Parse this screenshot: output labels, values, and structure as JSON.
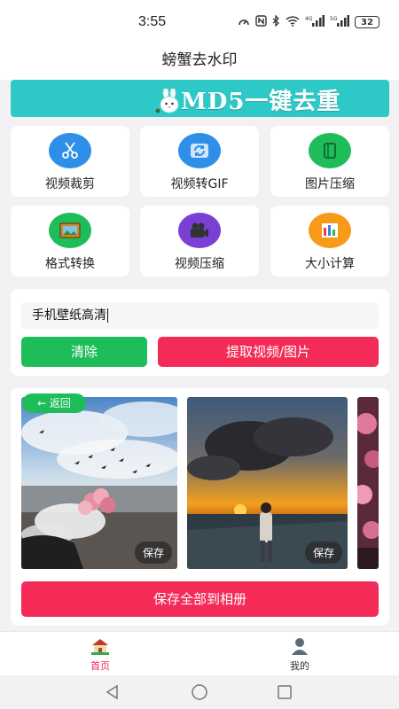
{
  "status_bar": {
    "time": "3:55",
    "battery": "32",
    "icons": [
      "speedometer-icon",
      "nfc-icon",
      "bluetooth-icon",
      "wifi-icon",
      "signal-4g-icon",
      "signal-5g-icon",
      "battery-icon"
    ],
    "network_labels": [
      "4G",
      "5G"
    ]
  },
  "app": {
    "title": "螃蟹去水印"
  },
  "banner": {
    "text": "MD5一键去重",
    "background": "#2ec9c6"
  },
  "tools": [
    {
      "label": "视频裁剪",
      "icon": "scissors-icon",
      "color": "#2f8fe8"
    },
    {
      "label": "视频转GIF",
      "icon": "refresh-icon",
      "color": "#2f8fe8"
    },
    {
      "label": "图片压缩",
      "icon": "compress-image-icon",
      "color": "#1ebd5a"
    },
    {
      "label": "格式转换",
      "icon": "picture-frame-icon",
      "color": "#1ebd5a"
    },
    {
      "label": "视频压缩",
      "icon": "video-camera-icon",
      "color": "#7b3fd6"
    },
    {
      "label": "大小计算",
      "icon": "bar-chart-icon",
      "color": "#f79a1a"
    }
  ],
  "search": {
    "value": "手机壁纸高清"
  },
  "buttons": {
    "clear": "清除",
    "extract": "提取视频/图片",
    "save_all": "保存全部到相册"
  },
  "gallery": {
    "back_label": "← 返回",
    "items": [
      {
        "save_label": "保存"
      },
      {
        "save_label": "保存"
      },
      {
        "save_label": ""
      }
    ]
  },
  "tabbar": {
    "items": [
      {
        "label": "首页",
        "icon": "home-icon",
        "active": true
      },
      {
        "label": "我的",
        "icon": "user-icon",
        "active": false
      }
    ]
  },
  "colors": {
    "accent_red": "#f42a57",
    "accent_green": "#1ebd5a",
    "banner_teal": "#2ec9c6"
  }
}
